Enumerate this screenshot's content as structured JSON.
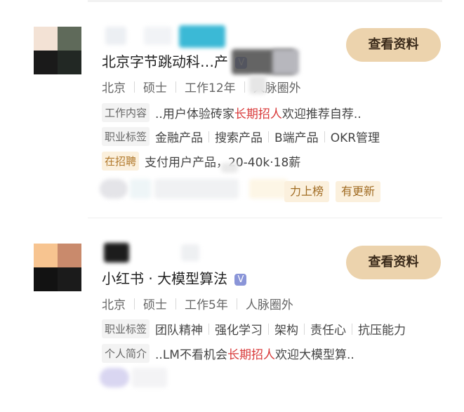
{
  "cards": [
    {
      "name": "北京字节跳动科…产",
      "verified": "V",
      "view_button": "查看资料",
      "meta": [
        "北京",
        "硕士",
        "工作12年",
        "人脉圈外"
      ],
      "work_label": "工作内容",
      "work_prefix": "..用户体验砖家",
      "work_highlight": "长期招人",
      "work_suffix": "欢迎推荐自荐..",
      "tags_label": "职业标签",
      "tags": [
        "金融产品",
        "搜索产品",
        "B端产品",
        "OKR管理"
      ],
      "hiring_label": "在招聘",
      "hiring_text": "支付用户产品，20-40k·18薪",
      "chips": [
        "力上榜",
        "有更新"
      ]
    },
    {
      "name": "小红书 · 大模型算法",
      "verified": "V",
      "view_button": "查看资料",
      "meta": [
        "北京",
        "硕士",
        "工作5年",
        "人脉圈外"
      ],
      "tags_label": "职业标签",
      "tags": [
        "团队精神",
        "强化学习",
        "架构",
        "责任心",
        "抗压能力"
      ],
      "intro_label": "个人简介",
      "intro_prefix": "..LM不看机会",
      "intro_highlight": "长期招人",
      "intro_suffix": "欢迎大模型算.."
    }
  ],
  "colors": {
    "button_bg": "#ecd3ad",
    "highlight": "#d93a3a",
    "badge": "#8a95d8",
    "hiring_label_bg": "#fbf0dd"
  }
}
